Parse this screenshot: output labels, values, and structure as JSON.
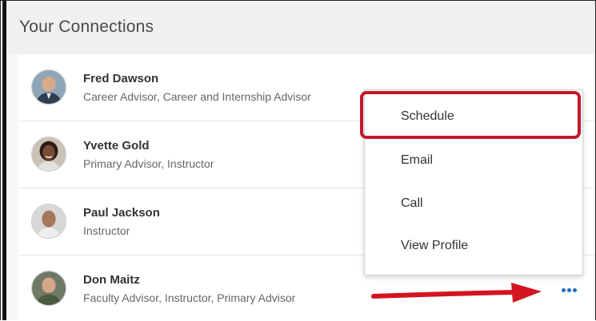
{
  "panel": {
    "title": "Your Connections"
  },
  "connections": [
    {
      "name": "Fred Dawson",
      "role": "Career Advisor, Career and Internship Advisor",
      "avatar": "fred-dawson-avatar"
    },
    {
      "name": "Yvette Gold",
      "role": "Primary Advisor, Instructor",
      "avatar": "yvette-gold-avatar"
    },
    {
      "name": "Paul Jackson",
      "role": "Instructor",
      "avatar": "paul-jackson-avatar"
    },
    {
      "name": "Don Maitz",
      "role": "Faculty Advisor, Instructor, Primary Advisor",
      "avatar": "don-maitz-avatar"
    }
  ],
  "menu": {
    "items": [
      {
        "label": "Schedule"
      },
      {
        "label": "Email"
      },
      {
        "label": "Call"
      },
      {
        "label": "View Profile"
      }
    ],
    "highlighted_item": "Schedule"
  },
  "icons": {
    "more": "more-options-icon",
    "annotation_arrow": "red-arrow-icon"
  },
  "colors": {
    "accent": "#1b6fc2",
    "highlight": "#c0192b",
    "arrow": "#d4141f"
  }
}
